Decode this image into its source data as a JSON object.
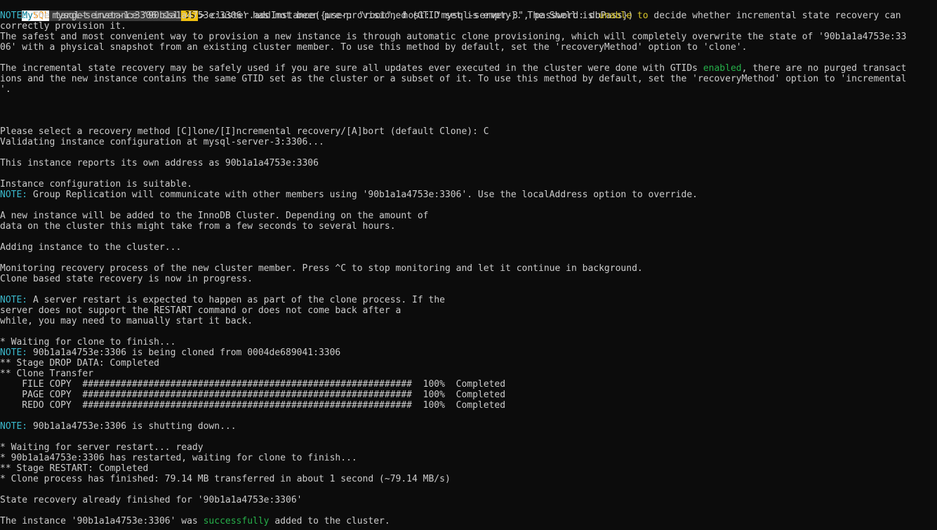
{
  "prompt": {
    "mysql_my": "My",
    "mysql_sql": "SQL",
    "host": "mysql-server-1:3306 ssl",
    "mode": "JS",
    "arrow": ">",
    "command": " cluster.addInstance({user: \"root\", host: \"mysql-server-3\", password: dbPass})"
  },
  "colors": {
    "background": "#0c0c0c",
    "text": "#cccccc",
    "note": "#3ab8cc",
    "highlight_yellow": "#d7c528",
    "highlight_green": "#26b04a",
    "mode_badge": "#f0c010"
  },
  "lines": [
    {
      "t": 1,
      "segs": [
        {
          "c": "note",
          "x": "NOTE:"
        },
        {
          "x": " The target instance '90b1a1a4753e:3306' has not been pre-provisioned (GTID set is empty). The Shell is "
        },
        {
          "c": "yellow",
          "x": "unable to"
        },
        {
          "x": " decide whether incremental state recovery can"
        }
      ]
    },
    {
      "t": 2,
      "segs": [
        {
          "x": "correctly provision it."
        }
      ]
    },
    {
      "t": 3,
      "segs": [
        {
          "x": "The safest and most convenient way to provision a new instance is through automatic clone provisioning, which will completely overwrite the state of '90b1a1a4753e:33"
        }
      ]
    },
    {
      "t": 4,
      "segs": [
        {
          "x": "06' with a physical snapshot from an existing cluster member. To use this method by default, set the 'recoveryMethod' option to 'clone'."
        }
      ]
    },
    {
      "t": 6,
      "segs": [
        {
          "x": "The incremental state recovery may be safely used if you are sure all updates ever executed in the cluster were done with GTIDs "
        },
        {
          "c": "green",
          "x": "enabled"
        },
        {
          "x": ", there are no purged transact"
        }
      ]
    },
    {
      "t": 7,
      "segs": [
        {
          "x": "ions and the new instance contains the same GTID set as the cluster or a subset of it. To use this method by default, set the 'recoveryMethod' option to 'incremental"
        }
      ]
    },
    {
      "t": 8,
      "segs": [
        {
          "x": "'."
        }
      ]
    },
    {
      "t": 12,
      "segs": [
        {
          "x": "Please select a recovery method [C]lone/[I]ncremental recovery/[A]bort (default Clone): C"
        }
      ]
    },
    {
      "t": 13,
      "segs": [
        {
          "x": "Validating instance configuration at mysql-server-3:3306..."
        }
      ]
    },
    {
      "t": 15,
      "segs": [
        {
          "x": "This instance reports its own address as 90b1a1a4753e:3306"
        }
      ]
    },
    {
      "t": 17,
      "segs": [
        {
          "x": "Instance configuration is suitable."
        }
      ]
    },
    {
      "t": 18,
      "segs": [
        {
          "c": "note",
          "x": "NOTE:"
        },
        {
          "x": " Group Replication will communicate with other members using '90b1a1a4753e:3306'. Use the localAddress option to override."
        }
      ]
    },
    {
      "t": 20,
      "segs": [
        {
          "x": "A new instance will be added to the InnoDB Cluster. Depending on the amount of"
        }
      ]
    },
    {
      "t": 21,
      "segs": [
        {
          "x": "data on the cluster this might take from a few seconds to several hours."
        }
      ]
    },
    {
      "t": 23,
      "segs": [
        {
          "x": "Adding instance to the cluster..."
        }
      ]
    },
    {
      "t": 25,
      "segs": [
        {
          "x": "Monitoring recovery process of the new cluster member. Press ^C to stop monitoring and let it continue in background."
        }
      ]
    },
    {
      "t": 26,
      "segs": [
        {
          "x": "Clone based state recovery is now in progress."
        }
      ]
    },
    {
      "t": 28,
      "segs": [
        {
          "c": "note",
          "x": "NOTE:"
        },
        {
          "x": " A server restart is expected to happen as part of the clone process. If the"
        }
      ]
    },
    {
      "t": 29,
      "segs": [
        {
          "x": "server does not support the RESTART command or does not come back after a"
        }
      ]
    },
    {
      "t": 30,
      "segs": [
        {
          "x": "while, you may need to manually start it back."
        }
      ]
    },
    {
      "t": 32,
      "segs": [
        {
          "x": "* Waiting for clone to finish..."
        }
      ]
    },
    {
      "t": 33,
      "segs": [
        {
          "c": "note",
          "x": "NOTE:"
        },
        {
          "x": " 90b1a1a4753e:3306 is being cloned from 0004de689041:3306"
        }
      ]
    },
    {
      "t": 34,
      "segs": [
        {
          "x": "** Stage DROP DATA: Completed"
        }
      ]
    },
    {
      "t": 35,
      "segs": [
        {
          "x": "** Clone Transfer"
        }
      ]
    },
    {
      "t": 36,
      "segs": [
        {
          "x": "    FILE COPY  ############################################################  100%  Completed"
        }
      ]
    },
    {
      "t": 37,
      "segs": [
        {
          "x": "    PAGE COPY  ############################################################  100%  Completed"
        }
      ]
    },
    {
      "t": 38,
      "segs": [
        {
          "x": "    REDO COPY  ############################################################  100%  Completed"
        }
      ]
    },
    {
      "t": 40,
      "segs": [
        {
          "c": "note",
          "x": "NOTE:"
        },
        {
          "x": " 90b1a1a4753e:3306 is shutting down..."
        }
      ]
    },
    {
      "t": 42,
      "segs": [
        {
          "x": "* Waiting for server restart... ready"
        }
      ]
    },
    {
      "t": 43,
      "segs": [
        {
          "x": "* 90b1a1a4753e:3306 has restarted, waiting for clone to finish..."
        }
      ]
    },
    {
      "t": 44,
      "segs": [
        {
          "x": "** Stage RESTART: Completed"
        }
      ]
    },
    {
      "t": 45,
      "segs": [
        {
          "x": "* Clone process has finished: 79.14 MB transferred in about 1 second (~79.14 MB/s)"
        }
      ]
    },
    {
      "t": 47,
      "segs": [
        {
          "x": "State recovery already finished for '90b1a1a4753e:3306'"
        }
      ]
    },
    {
      "t": 49,
      "segs": [
        {
          "x": "The instance '90b1a1a4753e:3306' was "
        },
        {
          "c": "green",
          "x": "successfully"
        },
        {
          "x": " added to the cluster."
        }
      ]
    }
  ]
}
